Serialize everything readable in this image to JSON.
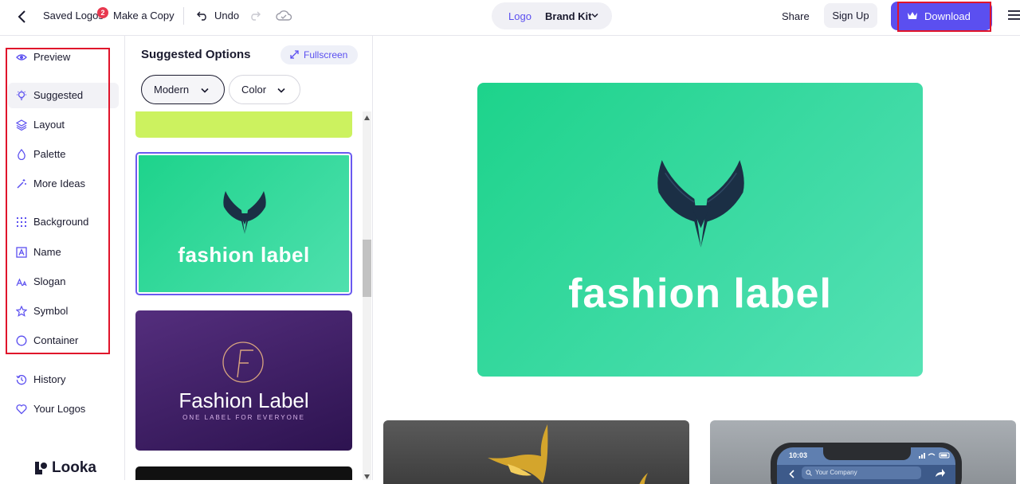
{
  "topbar": {
    "saved_logos": "Saved Logos",
    "saved_count": "2",
    "make_copy": "Make a Copy",
    "undo": "Undo",
    "tab_logo": "Logo",
    "tab_brand_kit": "Brand Kit",
    "share": "Share",
    "sign_up": "Sign Up",
    "download": "Download"
  },
  "sidebar": {
    "items": [
      {
        "label": "Preview",
        "icon": "eye-icon"
      },
      {
        "label": "Suggested",
        "icon": "lightbulb-icon",
        "active": true
      },
      {
        "label": "Layout",
        "icon": "layers-icon"
      },
      {
        "label": "Palette",
        "icon": "droplet-icon"
      },
      {
        "label": "More Ideas",
        "icon": "magic-wand-icon"
      },
      {
        "label": "Background",
        "icon": "grid-icon"
      },
      {
        "label": "Name",
        "icon": "text-box-icon"
      },
      {
        "label": "Slogan",
        "icon": "font-size-icon"
      },
      {
        "label": "Symbol",
        "icon": "star-icon"
      },
      {
        "label": "Container",
        "icon": "circle-icon"
      },
      {
        "label": "History",
        "icon": "history-icon"
      },
      {
        "label": "Your Logos",
        "icon": "heart-icon"
      }
    ],
    "brand": "Looka"
  },
  "options": {
    "title": "Suggested Options",
    "fullscreen": "Fullscreen",
    "style_filter": "Modern",
    "color_filter": "Color",
    "cards": [
      {
        "name": "fashion label",
        "colors": [
          "#1dd38b",
          "#4fe0ae"
        ],
        "selected": true
      },
      {
        "name": "Fashion Label",
        "slogan": "ONE LABEL FOR EVERYONE",
        "colors": [
          "#542e7d",
          "#2d1350"
        ]
      }
    ]
  },
  "preview": {
    "logo_text": "fashion label",
    "phone_time": "10:03",
    "phone_search": "Your Company"
  },
  "colors": {
    "accent": "#5b4ff0",
    "logo_green": "#1dd38b",
    "wing_navy": "#1b2f45",
    "highlight_red": "#e0142b"
  }
}
